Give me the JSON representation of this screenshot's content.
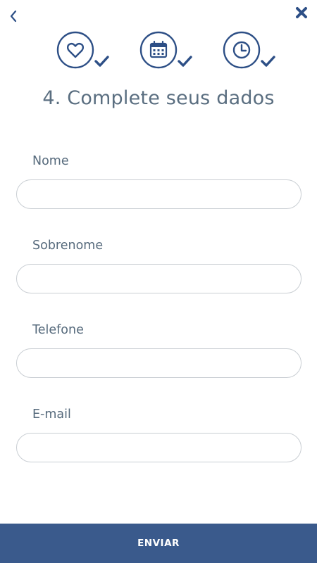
{
  "header": {
    "back_icon": "chevron-left-icon",
    "close_icon": "close-icon"
  },
  "steps": [
    {
      "icon": "heart-icon",
      "completed": true
    },
    {
      "icon": "calendar-icon",
      "completed": true
    },
    {
      "icon": "clock-icon",
      "completed": true
    }
  ],
  "page_title": "4. Complete seus dados",
  "form": {
    "fields": [
      {
        "label": "Nome",
        "value": "",
        "placeholder": ""
      },
      {
        "label": "Sobrenome",
        "value": "",
        "placeholder": ""
      },
      {
        "label": "Telefone",
        "value": "",
        "placeholder": ""
      },
      {
        "label": "E-mail",
        "value": "",
        "placeholder": ""
      }
    ],
    "submit_label": "ENVIAR"
  },
  "colors": {
    "accent": "#2d4f86",
    "button": "#3a5a8c",
    "text": "#566a7c",
    "input_border": "#c9ced3"
  }
}
